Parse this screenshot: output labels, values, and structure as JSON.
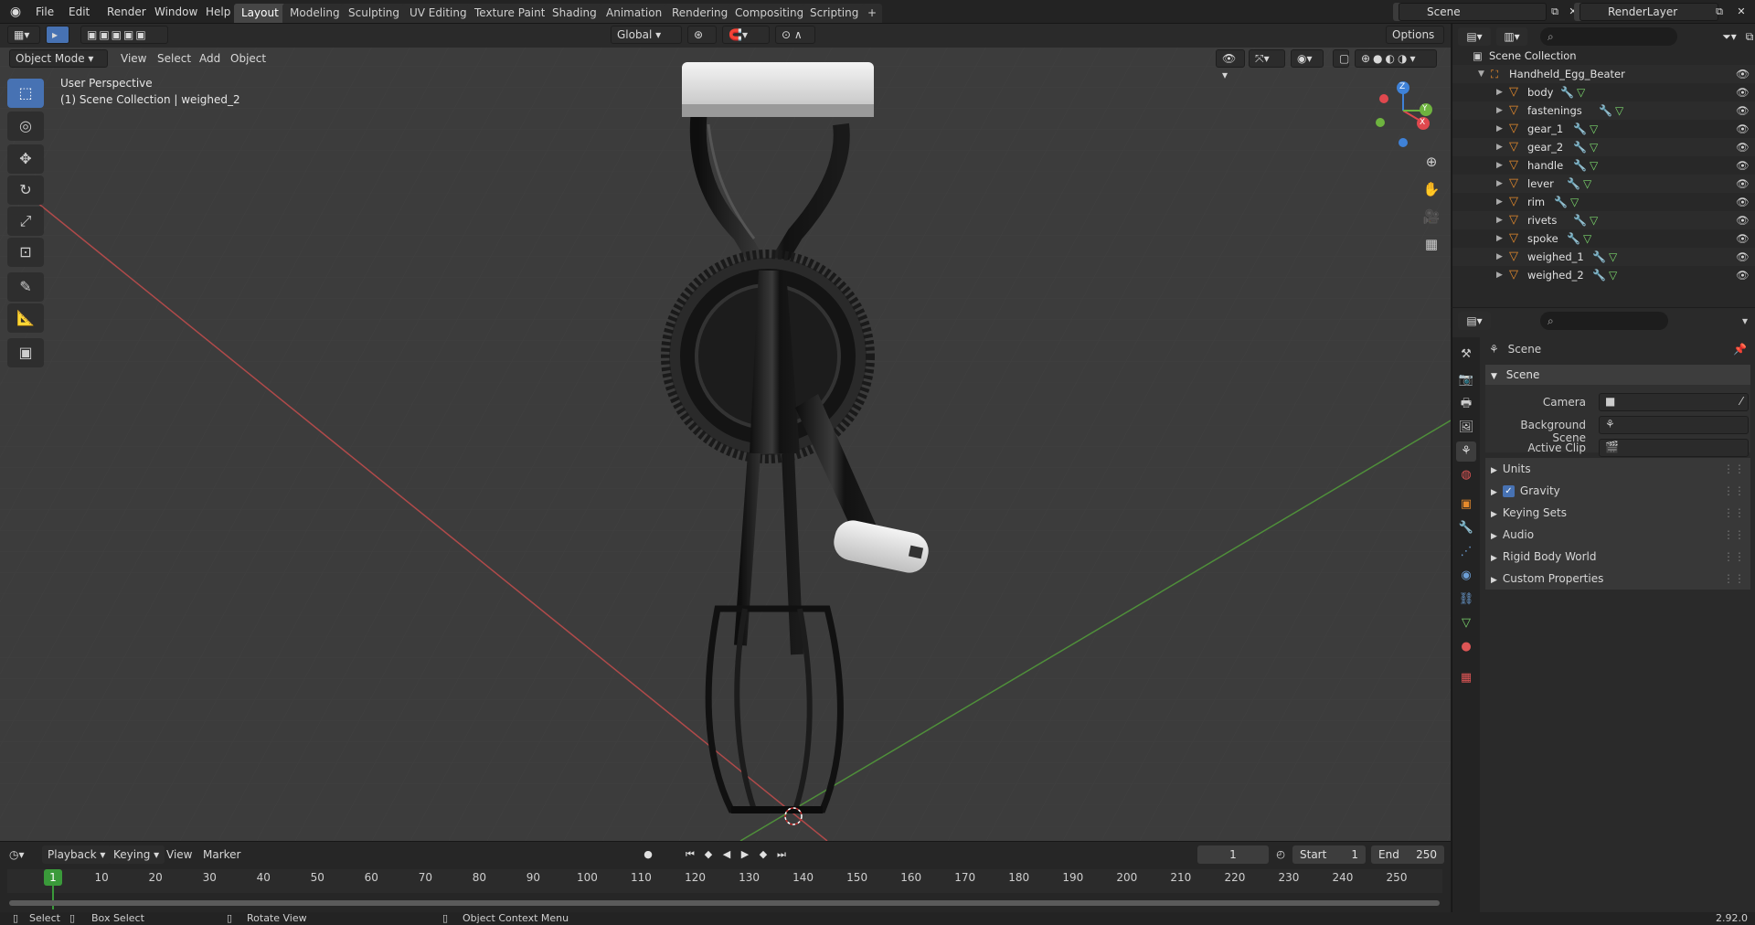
{
  "app": {
    "name": "Blender",
    "version": "2.92.0"
  },
  "menu": [
    "File",
    "Edit",
    "Render",
    "Window",
    "Help"
  ],
  "workspaces": [
    "Layout",
    "Modeling",
    "Sculpting",
    "UV Editing",
    "Texture Paint",
    "Shading",
    "Animation",
    "Rendering",
    "Compositing",
    "Scripting"
  ],
  "active_workspace": "Layout",
  "scene_name": "Scene",
  "view_layer": "RenderLayer",
  "toolbar": {
    "transform_orientation": "Global",
    "options_label": "Options"
  },
  "viewport_header": {
    "mode": "Object Mode",
    "menus": [
      "View",
      "Select",
      "Add",
      "Object"
    ]
  },
  "viewport": {
    "perspective_label": "User Perspective",
    "collection_label": "(1) Scene Collection | weighed_2",
    "gizmo_axes": [
      "X",
      "Y",
      "Z"
    ]
  },
  "outliner": {
    "root": "Scene Collection",
    "collection": "Handheld_Egg_Beater",
    "objects": [
      "body",
      "fastenings",
      "gear_1",
      "gear_2",
      "handle",
      "lever",
      "rim",
      "rivets",
      "spoke",
      "weighed_1",
      "weighed_2"
    ]
  },
  "properties": {
    "context": "Scene",
    "panel": "Scene",
    "fields": [
      {
        "label": "Camera"
      },
      {
        "label": "Background Scene"
      },
      {
        "label": "Active Clip"
      }
    ],
    "subpanels": [
      "Units",
      "Gravity",
      "Keying Sets",
      "Audio",
      "Rigid Body World",
      "Custom Properties"
    ],
    "gravity_enabled": true
  },
  "timeline": {
    "menus": [
      "Playback",
      "Keying",
      "View",
      "Marker"
    ],
    "current_frame": "1",
    "start_label": "Start",
    "start": "1",
    "end_label": "End",
    "end": "250",
    "ruler_labels": [
      "1",
      "10",
      "20",
      "30",
      "40",
      "50",
      "60",
      "70",
      "80",
      "90",
      "100",
      "110",
      "120",
      "130",
      "140",
      "150",
      "160",
      "170",
      "180",
      "190",
      "200",
      "210",
      "220",
      "230",
      "240",
      "250"
    ]
  },
  "statusbar": {
    "items": [
      "Select",
      "Box Select",
      "Rotate View",
      "Object Context Menu"
    ]
  },
  "colors": {
    "accent": "#4772b3",
    "x_axis": "#e0484e",
    "y_axis": "#6eb33f",
    "z_axis": "#3f82d8",
    "playhead": "#3a9a3a",
    "object_icon": "#e58a2c"
  }
}
